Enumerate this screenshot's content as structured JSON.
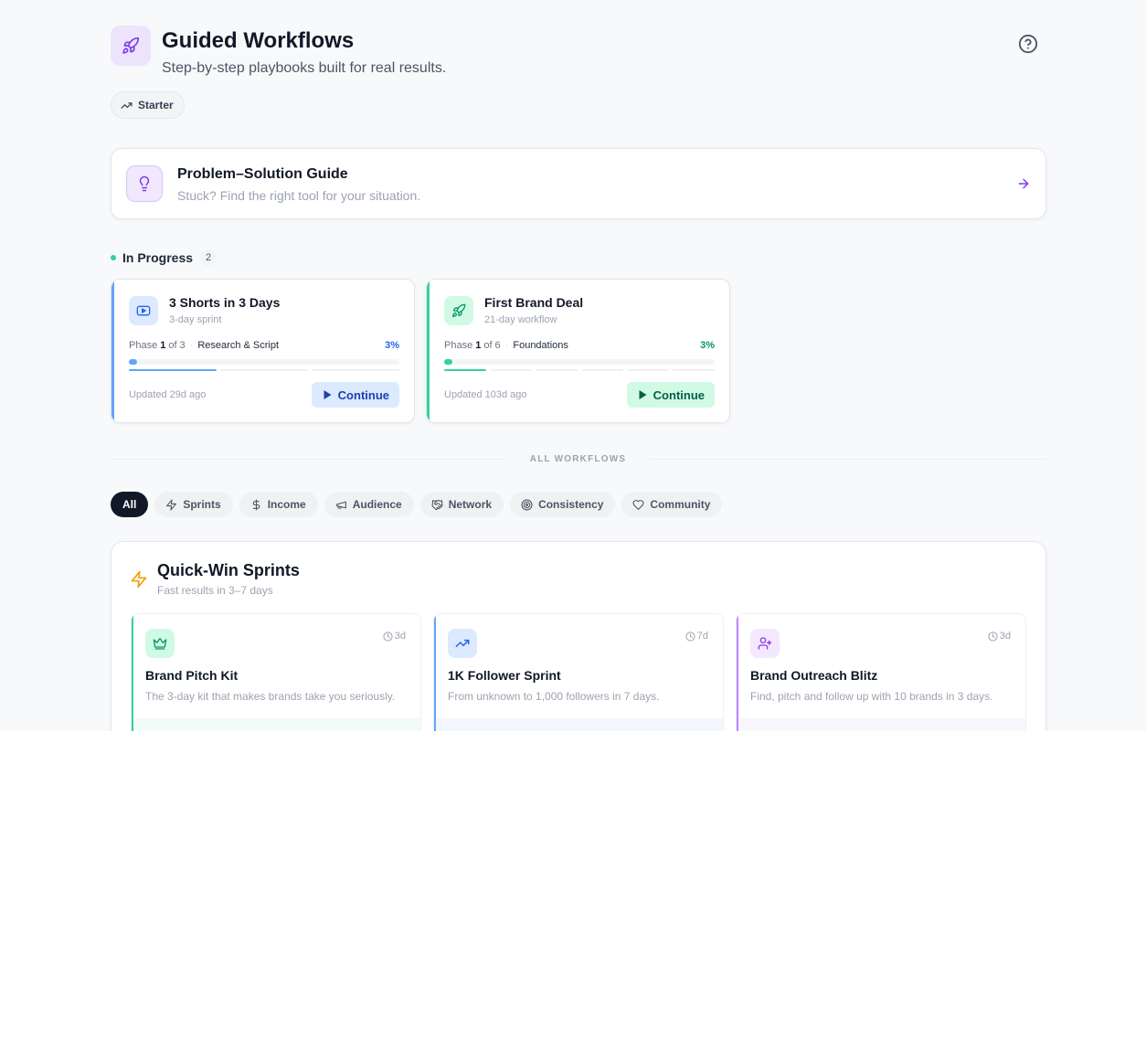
{
  "header": {
    "title": "Guided Workflows",
    "subtitle": "Step-by-step playbooks built for real results.",
    "tier_badge": "Starter"
  },
  "guide": {
    "title": "Problem–Solution Guide",
    "subtitle": "Stuck? Find the right tool for your situation."
  },
  "in_progress": {
    "label": "In Progress",
    "count": "2",
    "cards": [
      {
        "title": "3 Shorts in 3 Days",
        "subtitle": "3-day sprint",
        "phase_prefix": "Phase",
        "phase_current": "1",
        "phase_of": "of 3",
        "phase_name": "Research & Script",
        "percent": "3%",
        "progress": 0.03,
        "segments": 3,
        "segments_done": 1,
        "updated": "Updated 29d ago",
        "continue_label": "Continue",
        "icon": "play-video-icon",
        "accent": "#60a5fa",
        "icon_bg": "#dbeafe",
        "icon_color": "#2563eb",
        "pct_color": "#2563eb",
        "btn_bg": "#dbeafe",
        "btn_color": "#1e40af"
      },
      {
        "title": "First Brand Deal",
        "subtitle": "21-day workflow",
        "phase_prefix": "Phase",
        "phase_current": "1",
        "phase_of": "of 6",
        "phase_name": "Foundations",
        "percent": "3%",
        "progress": 0.03,
        "segments": 6,
        "segments_done": 1,
        "updated": "Updated 103d ago",
        "continue_label": "Continue",
        "icon": "rocket-icon",
        "accent": "#34d399",
        "icon_bg": "#d1fae5",
        "icon_color": "#059669",
        "pct_color": "#059669",
        "btn_bg": "#d1fae5",
        "btn_color": "#065f46"
      }
    ]
  },
  "all_workflows_label": "ALL WORKFLOWS",
  "filters": [
    {
      "label": "All",
      "icon": "",
      "active": true
    },
    {
      "label": "Sprints",
      "icon": "lightning-icon",
      "active": false
    },
    {
      "label": "Income",
      "icon": "dollar-icon",
      "active": false
    },
    {
      "label": "Audience",
      "icon": "megaphone-icon",
      "active": false
    },
    {
      "label": "Network",
      "icon": "handshake-icon",
      "active": false
    },
    {
      "label": "Consistency",
      "icon": "target-icon",
      "active": false
    },
    {
      "label": "Community",
      "icon": "heart-icon",
      "active": false
    }
  ],
  "quick_win": {
    "title": "Quick-Win Sprints",
    "subtitle": "Fast results in 3–7 days",
    "cards": [
      {
        "title": "Brand Pitch Kit",
        "description": "The 3-day kit that makes brands take you seriously.",
        "duration": "3d",
        "icon": "crown-icon",
        "accent": "#34d399",
        "icon_bg": "#d1fae5",
        "icon_color": "#059669",
        "foot_bg": "#f3fbf7"
      },
      {
        "title": "1K Follower Sprint",
        "description": "From unknown to 1,000 followers in 7 days.",
        "duration": "7d",
        "icon": "trending-up-icon",
        "accent": "#60a5fa",
        "icon_bg": "#dbeafe",
        "icon_color": "#2563eb",
        "foot_bg": "#f3f7fd"
      },
      {
        "title": "Brand Outreach Blitz",
        "description": "Find, pitch and follow up with 10 brands in 3 days.",
        "duration": "3d",
        "icon": "user-plus-icon",
        "accent": "#c084fc",
        "icon_bg": "#f3e8ff",
        "icon_color": "#9333ea",
        "foot_bg": "#faf6fe"
      }
    ]
  }
}
